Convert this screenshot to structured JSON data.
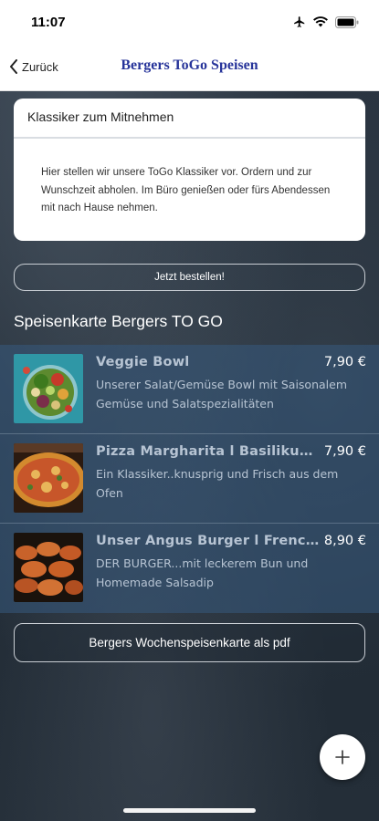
{
  "status": {
    "time": "11:07"
  },
  "nav": {
    "back_label": "Zurück",
    "title": "Bergers ToGo Speisen"
  },
  "card": {
    "title": "Klassiker zum Mitnehmen",
    "body": "Hier stellen wir unsere ToGo Klassiker vor. Ordern und zur Wunschzeit abholen. Im Büro genießen oder fürs Abendessen mit nach Hause nehmen."
  },
  "order_button": "Jetzt bestellen!",
  "section_title": "Speisenkarte Bergers TO GO",
  "menu_items": [
    {
      "name": "Veggie Bowl",
      "price": "7,90 €",
      "desc": "Unserer Salat/Gemüse Bowl mit Saisonalem Gemüse und Salatspezialitäten",
      "image": "salad-bowl"
    },
    {
      "name": "Pizza Margharita l Basilikum...",
      "price": "7,90 €",
      "desc": "Ein Klassiker..knusprig und Frisch aus dem Ofen",
      "image": "pizza"
    },
    {
      "name": "Unser Angus Burger l French...",
      "price": "8,90 €",
      "desc": "DER BURGER...mit leckerem Bun und Homemade Salsadip",
      "image": "burger-buns"
    }
  ],
  "pdf_button": "Bergers Wochenspeisenkarte als pdf",
  "fab_icon": "plus-icon"
}
